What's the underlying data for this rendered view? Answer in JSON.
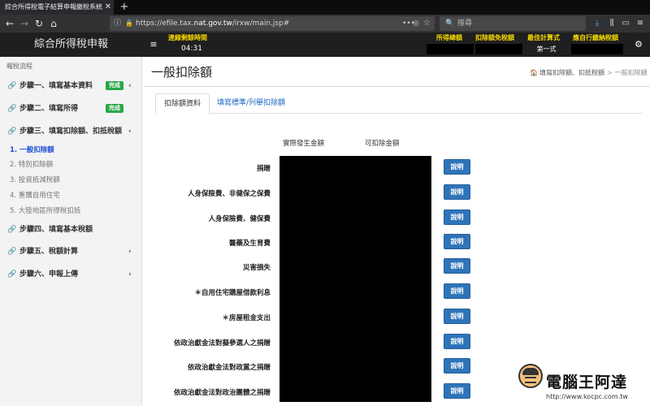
{
  "browser": {
    "tab_title": "綜合所得稅電子結算申報繳稅系統",
    "url_prefix": "https://efile.tax.",
    "url_domain": "nat.gov.tw",
    "url_path": "/irxw/main.jsp#",
    "search_placeholder": "搜尋",
    "icons": {
      "back": "←",
      "forward": "→",
      "reload": "↻",
      "home": "⌂",
      "info": "ⓘ",
      "lock": "🔒",
      "more": "•••",
      "pocket": "◎",
      "star": "☆",
      "search": "🔍",
      "download": "⤓",
      "library": "⫼",
      "sidebar": "▭",
      "menu": "≡",
      "close": "✕",
      "new_tab": "+"
    }
  },
  "header": {
    "brand": "綜合所得稅申報",
    "menu_icon": "≡",
    "connection_label": "連線剩餘時間",
    "connection_time": "04:31",
    "columns": [
      {
        "label": "所得總額",
        "value": ""
      },
      {
        "label": "扣除額免稅額",
        "value": ""
      },
      {
        "label": "最佳計算式",
        "value": "第一式"
      },
      {
        "label": "應自行繳納稅額",
        "value": ""
      }
    ],
    "gear_icon": "⚙"
  },
  "sidebar": {
    "header": "報稅流程",
    "steps": [
      {
        "label": "步驟一、填寫基本資料",
        "badge": "完成",
        "chevron": "‹"
      },
      {
        "label": "步驟二、填寫所得",
        "badge": "完成",
        "chevron": ""
      },
      {
        "label": "步驟三、填寫扣除額、扣抵稅額",
        "badge": "",
        "chevron": "‹"
      },
      {
        "label": "步驟四、填寫基本稅額",
        "badge": "",
        "chevron": ""
      },
      {
        "label": "步驟五、稅額計算",
        "badge": "",
        "chevron": "‹"
      },
      {
        "label": "步驟六、申報上傳",
        "badge": "",
        "chevron": "‹"
      }
    ],
    "sub_items": [
      "1. 一般扣除額",
      "2. 特別扣除額",
      "3. 投資抵減稅額",
      "4. 重購自用住宅",
      "5. 大陸地區所得稅扣抵"
    ],
    "step_icon": "🔗"
  },
  "main": {
    "title": "一般扣除額",
    "breadcrumb": {
      "icon": "🏠",
      "parent": "填寫扣除額、扣抵稅額",
      "separator": ">",
      "current": "一般扣除額"
    },
    "tabs": [
      "扣除額資料",
      "填寫標準/列舉扣除額"
    ],
    "col_headers": [
      "實際發生金額",
      "可扣除金額"
    ],
    "rows": [
      {
        "label": "捐贈",
        "button": "說明"
      },
      {
        "label": "人身保險費、非健保之保費",
        "button": "說明"
      },
      {
        "label": "人身保險費、健保費",
        "button": "說明"
      },
      {
        "label": "醫藥及生育費",
        "button": "說明"
      },
      {
        "label": "災害損失",
        "button": "說明"
      },
      {
        "label": "＊自用住宅購屋借款利息",
        "button": "說明"
      },
      {
        "label": "＊房屋租金支出",
        "button": "說明"
      },
      {
        "label": "依政治獻金法對擬參選人之捐贈",
        "button": "說明"
      },
      {
        "label": "依政治獻金法對政黨之捐贈",
        "button": "說明"
      },
      {
        "label": "依政治獻金法對政治團體之捐贈",
        "button": "說明"
      }
    ]
  },
  "watermark": {
    "title": "電腦王阿達",
    "url": "http://www.kocpc.com.tw"
  }
}
